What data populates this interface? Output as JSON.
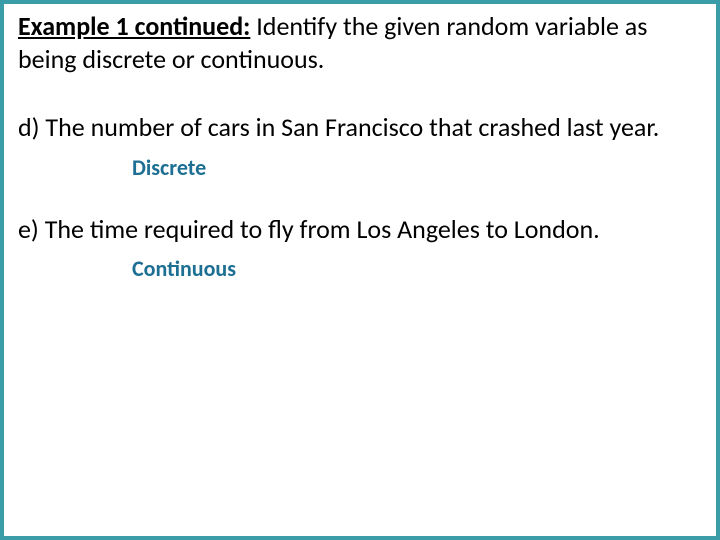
{
  "heading": {
    "label": "Example 1 continued:",
    "text": " Identify the given random variable as being discrete or continuous."
  },
  "items": [
    {
      "question": "d) The number of cars in San Francisco that crashed last year.",
      "answer": "Discrete"
    },
    {
      "question": "e) The time required to fly from Los Angeles to London.",
      "answer": "Continuous"
    }
  ]
}
